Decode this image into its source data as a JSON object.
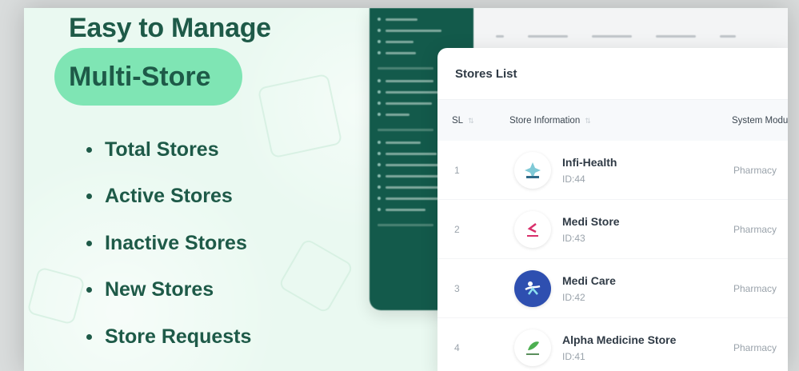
{
  "promo": {
    "headline": "Easy to Manage",
    "highlight": "Multi-Store",
    "features": [
      "Total Stores",
      "Active Stores",
      "Inactive Stores",
      "New Stores",
      "Store Requests"
    ]
  },
  "stores_card": {
    "title": "Stores List",
    "columns": {
      "sl": "SL",
      "info": "Store Information",
      "module": "System Modu"
    },
    "rows": [
      {
        "sl": "1",
        "name": "Infi-Health",
        "id": "ID:44",
        "module": "Pharmacy",
        "logo_icon": "infi-health-logo-icon"
      },
      {
        "sl": "2",
        "name": "Medi Store",
        "id": "ID:43",
        "module": "Pharmacy",
        "logo_icon": "medi-store-logo-icon"
      },
      {
        "sl": "3",
        "name": "Medi Care",
        "id": "ID:42",
        "module": "Pharmacy",
        "logo_icon": "medi-care-logo-icon"
      },
      {
        "sl": "4",
        "name": "Alpha Medicine Store",
        "id": "ID:41",
        "module": "Pharmacy",
        "logo_icon": "alpha-medicine-logo-icon"
      }
    ]
  },
  "colors": {
    "brand_dark": "#1e5a48",
    "highlight_bg": "#7fe5b4",
    "sidebar_bg": "#135a4b",
    "page_bg": "#eaf9f1"
  }
}
